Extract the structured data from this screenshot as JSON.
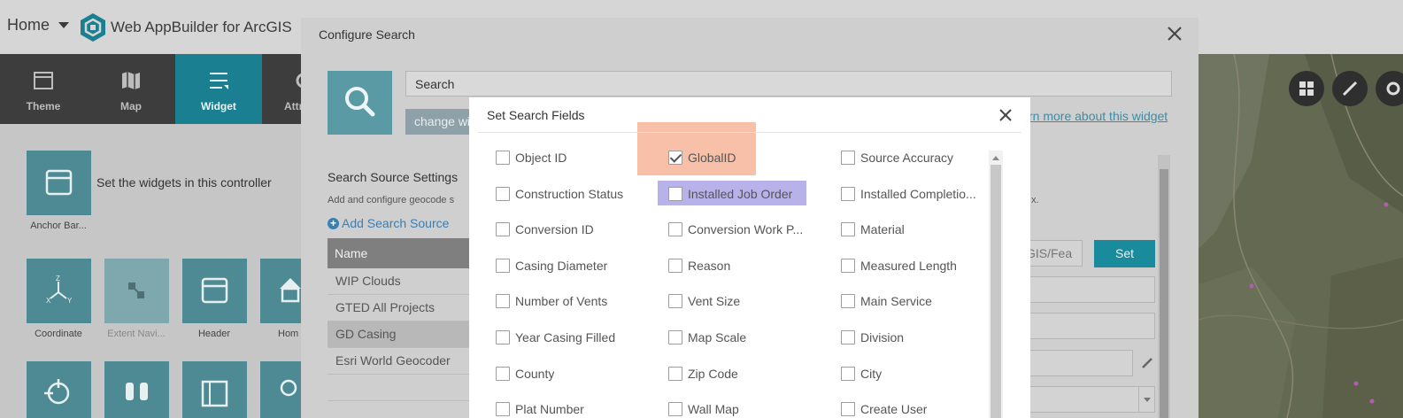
{
  "header": {
    "home_label": "Home",
    "app_title": "Web AppBuilder for ArcGIS"
  },
  "tabs": [
    {
      "label": "Theme",
      "icon": "theme-icon",
      "active": false
    },
    {
      "label": "Map",
      "icon": "map-icon",
      "active": false
    },
    {
      "label": "Widget",
      "icon": "widget-icon",
      "active": true
    },
    {
      "label": "Attr",
      "icon": "attribute-icon",
      "active": false
    }
  ],
  "left_panel": {
    "controller_label": "Set the widgets in this controller",
    "anchor_label": "Anchor Bar...",
    "widgets": [
      {
        "label": "Coordinate",
        "icon": "coordinate-icon"
      },
      {
        "label": "Extent Navi...",
        "icon": "extent-navigate-icon"
      },
      {
        "label": "Header",
        "icon": "header-icon"
      },
      {
        "label": "Hom",
        "icon": "home-icon"
      }
    ]
  },
  "config_dialog": {
    "title": "Configure Search",
    "name_value": "Search",
    "change_button": "change wi",
    "learn_more": "rn more about this widget",
    "source_settings_heading": "Search Source Settings",
    "source_settings_desc": "Add and configure geocode s",
    "source_settings_desc_right": "x.",
    "add_source": "Add Search Source",
    "table_header": "Name",
    "sources": [
      {
        "name": "WIP Clouds",
        "selected": false
      },
      {
        "name": "GTED All Projects",
        "selected": false
      },
      {
        "name": "GD Casing",
        "selected": true
      },
      {
        "name": "Esri World Geocoder",
        "selected": false
      }
    ],
    "url_value": "GIS/Fea",
    "set_button": "Set"
  },
  "fields_dialog": {
    "title": "Set Search Fields",
    "fields": [
      {
        "label": "Object ID",
        "checked": false
      },
      {
        "label": "GlobalID",
        "checked": true
      },
      {
        "label": "Source Accuracy",
        "checked": false
      },
      {
        "label": "Construction Status",
        "checked": false
      },
      {
        "label": "Installed Job Order",
        "checked": false
      },
      {
        "label": "Installed Completio...",
        "checked": false
      },
      {
        "label": "Conversion ID",
        "checked": false
      },
      {
        "label": "Conversion Work P...",
        "checked": false
      },
      {
        "label": "Material",
        "checked": false
      },
      {
        "label": "Casing Diameter",
        "checked": false
      },
      {
        "label": "Reason",
        "checked": false
      },
      {
        "label": "Measured Length",
        "checked": false
      },
      {
        "label": "Number of Vents",
        "checked": false
      },
      {
        "label": "Vent Size",
        "checked": false
      },
      {
        "label": "Main Service",
        "checked": false
      },
      {
        "label": "Year Casing Filled",
        "checked": false
      },
      {
        "label": "Map Scale",
        "checked": false
      },
      {
        "label": "Division",
        "checked": false
      },
      {
        "label": "County",
        "checked": false
      },
      {
        "label": "Zip Code",
        "checked": false
      },
      {
        "label": "City",
        "checked": false
      },
      {
        "label": "Plat Number",
        "checked": false
      },
      {
        "label": "Wall Map",
        "checked": false
      },
      {
        "label": "Create User",
        "checked": false
      }
    ]
  },
  "colors": {
    "accent": "#1a7f91",
    "highlight_orange": "#f8c0a8",
    "highlight_purple": "#b7b2e9"
  }
}
